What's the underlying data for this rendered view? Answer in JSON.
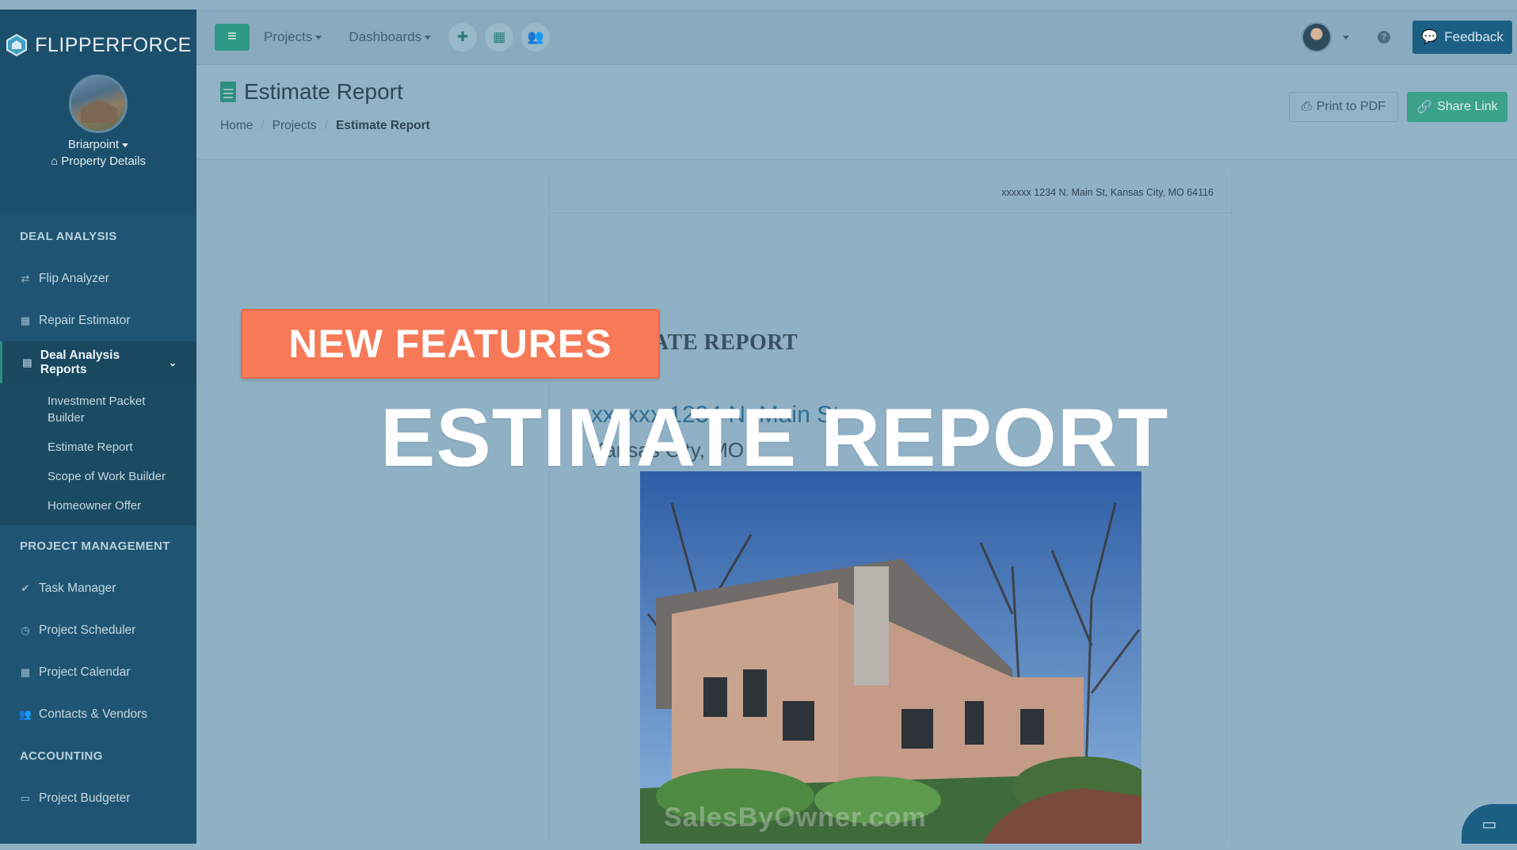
{
  "app": {
    "logo_text": "FLIPPERFORCE"
  },
  "property": {
    "name": "Briarpoint",
    "details_label": "Property Details"
  },
  "sidebar": {
    "sections": [
      {
        "title": "DEAL ANALYSIS"
      },
      {
        "title": "PROJECT MANAGEMENT"
      },
      {
        "title": "ACCOUNTING"
      }
    ],
    "deal_items": [
      "Flip Analyzer",
      "Repair Estimator",
      "Deal Analysis Reports"
    ],
    "submenu": [
      "Investment Packet Builder",
      "Estimate Report",
      "Scope of Work Builder",
      "Homeowner Offer"
    ],
    "pm_items": [
      "Task Manager",
      "Project Scheduler",
      "Project Calendar",
      "Contacts & Vendors"
    ],
    "acct_items": [
      "Project Budgeter"
    ]
  },
  "topbar": {
    "projects": "Projects",
    "dashboards": "Dashboards",
    "feedback": "Feedback"
  },
  "page": {
    "title": "Estimate Report",
    "breadcrumb": [
      "Home",
      "Projects",
      "Estimate Report"
    ],
    "print_pdf": "Print to PDF",
    "share_link": "Share Link"
  },
  "report": {
    "header_address": "xxxxxx 1234 N. Main St, Kansas City, MO 64116",
    "heading": "ATE REPORT",
    "address_line": "xxxxxx 1234 N. Main St",
    "city_line": "Kansas City, MO",
    "watermark": "SalesByOwner.com"
  },
  "overlay": {
    "badge": "NEW FEATURES",
    "title": "ESTIMATE REPORT"
  },
  "colors": {
    "accent": "#2e9a85",
    "sidebar": "#1f5572",
    "badge": "#f67a58",
    "feedback": "#1c5f84"
  }
}
